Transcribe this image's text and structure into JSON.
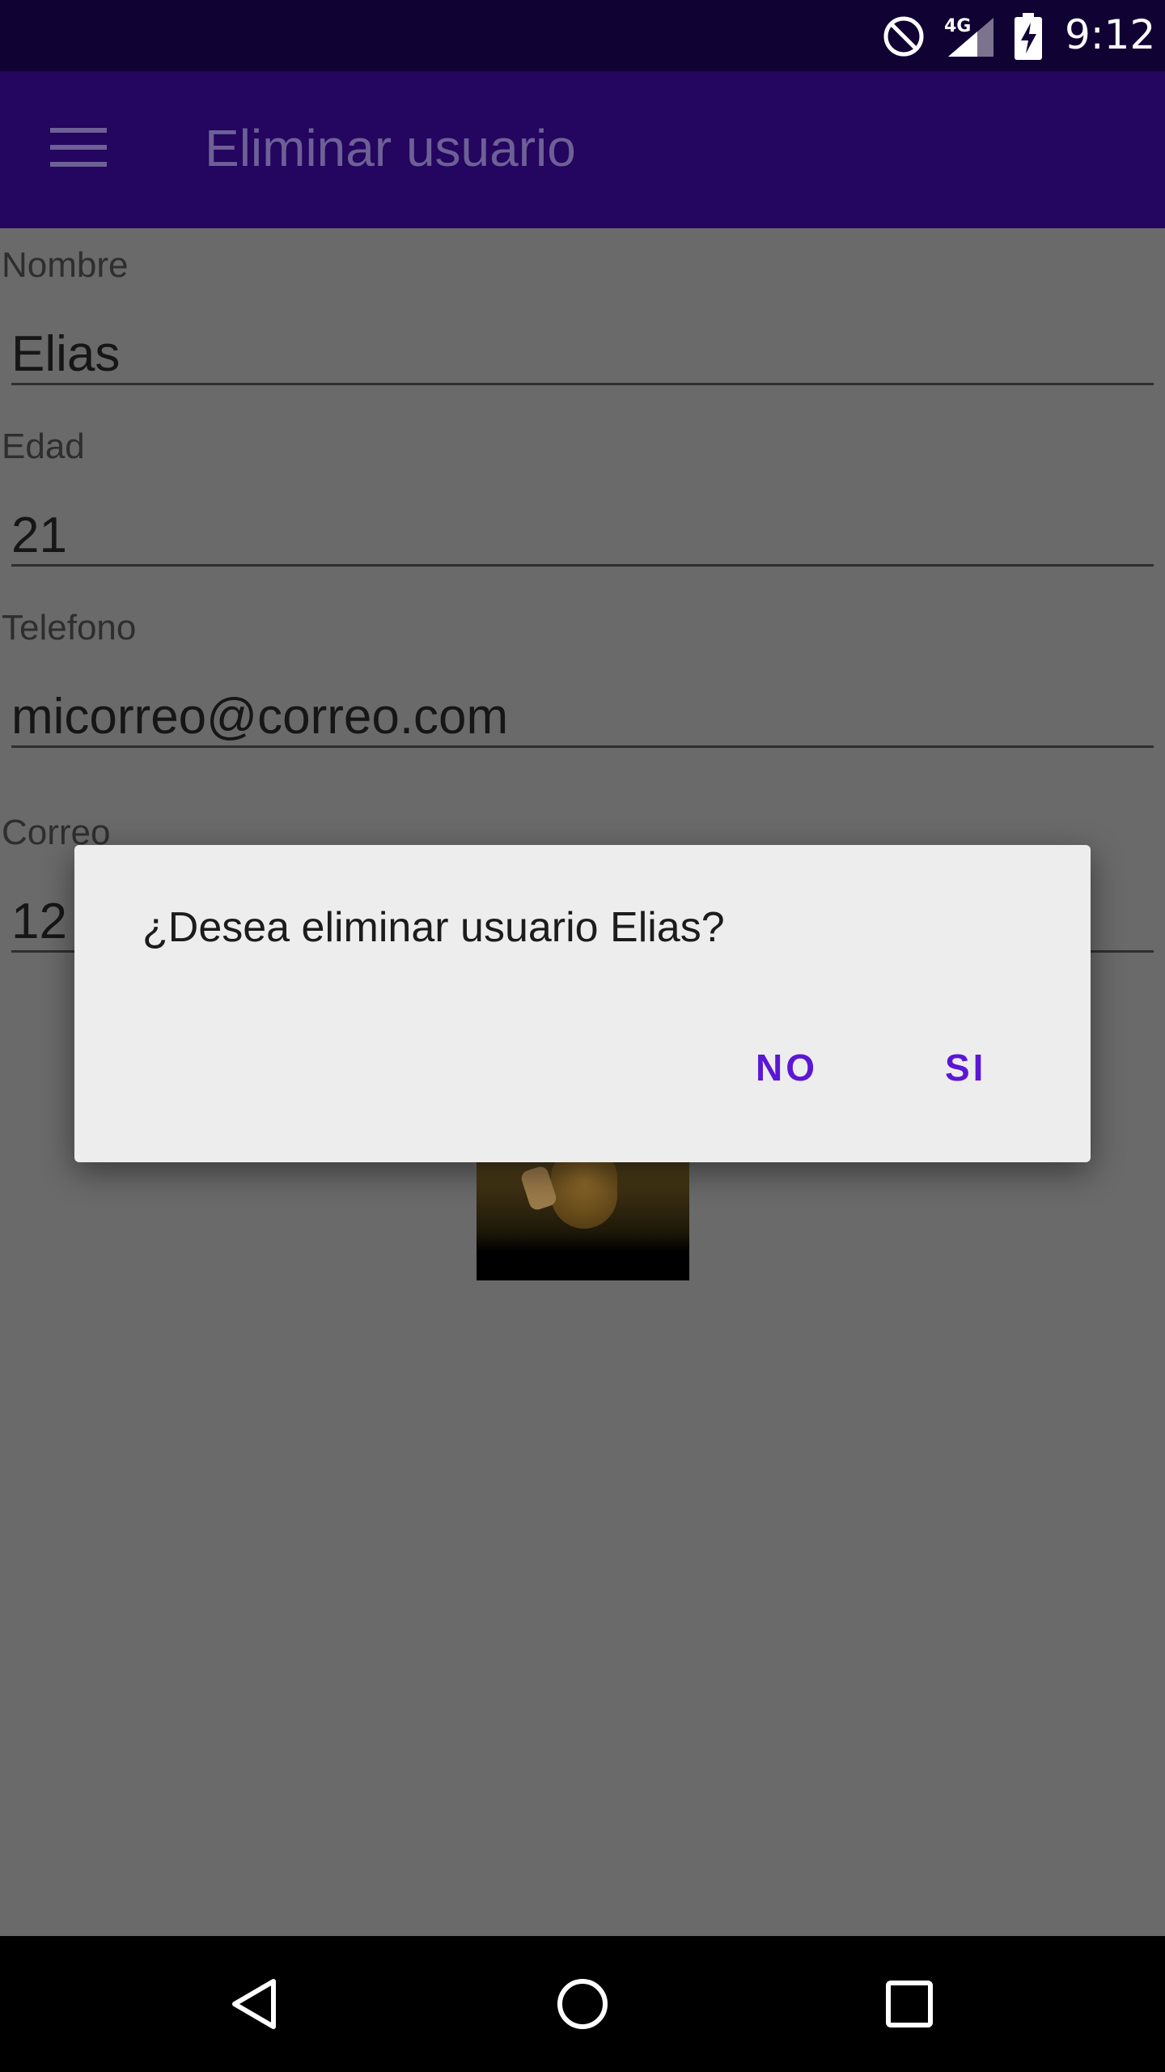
{
  "status_bar": {
    "network_type": "4G",
    "time": "9:12",
    "icons": [
      "do-not-disturb-icon",
      "signal-icon",
      "battery-charging-icon"
    ]
  },
  "app_bar": {
    "title": "Eliminar usuario",
    "menu_icon": "hamburger-menu-icon"
  },
  "form": {
    "fields": [
      {
        "label": "Nombre",
        "value": "Elias"
      },
      {
        "label": "Edad",
        "value": "21"
      },
      {
        "label": "Telefono",
        "value": "micorreo@correo.com"
      },
      {
        "label": "Correo",
        "value": "12"
      }
    ],
    "photo": "mona-lisa-peace-sign-photo"
  },
  "dialog": {
    "message": "¿Desea eliminar usuario Elias?",
    "no_label": "NO",
    "yes_label": "SI",
    "accent_color": "#5b16d6"
  },
  "nav_bar": {
    "icons": [
      "back-icon",
      "home-icon",
      "recents-icon"
    ]
  },
  "colors": {
    "status_bar": "#110234",
    "app_bar": "#24055f",
    "scrim_background": "#6a6a6a",
    "dialog_background": "#ededed"
  }
}
